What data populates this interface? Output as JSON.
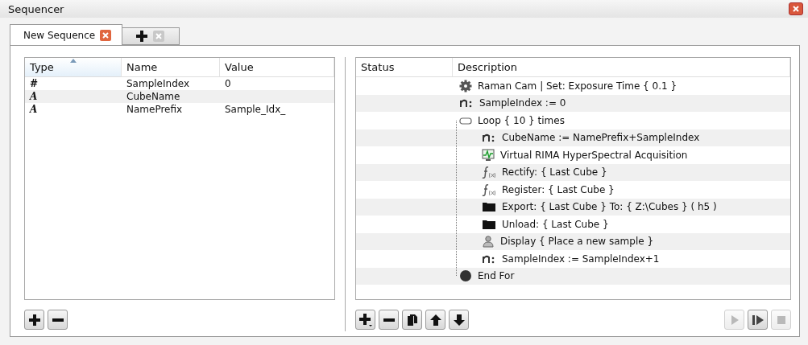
{
  "window": {
    "title": "Sequencer"
  },
  "tabs": [
    {
      "label": "New Sequence",
      "selected": true,
      "kind": "doc"
    },
    {
      "kind": "add",
      "selected": false
    }
  ],
  "variables": {
    "columns": [
      "Type",
      "Name",
      "Value"
    ],
    "rows": [
      {
        "type": "#",
        "name": "SampleIndex",
        "value": "0"
      },
      {
        "type": "A",
        "name": "CubeName",
        "value": ""
      },
      {
        "type": "A",
        "name": "NamePrefix",
        "value": "Sample_Idx_"
      }
    ]
  },
  "steps": {
    "columns": [
      "Status",
      "Description"
    ],
    "rows": [
      {
        "kind": "gear",
        "text": "Raman Cam | Set: Exposure Time { 0.1 }"
      },
      {
        "kind": "var",
        "text": "SampleIndex := 0"
      },
      {
        "kind": "loop",
        "text": "Loop { 10 } times",
        "children": [
          {
            "kind": "var",
            "text": "CubeName := NamePrefix+SampleIndex"
          },
          {
            "kind": "acq",
            "text": "Virtual RIMA HyperSpectral Acquisition"
          },
          {
            "kind": "func",
            "text": "Rectify: { Last Cube }"
          },
          {
            "kind": "func",
            "text": "Register: { Last Cube }"
          },
          {
            "kind": "folder",
            "text": "Export: { Last Cube } To: { Z:\\Cubes } ( h5 )"
          },
          {
            "kind": "folder",
            "text": "Unload: { Last Cube }"
          },
          {
            "kind": "user",
            "text": "Display { Place a new sample }"
          },
          {
            "kind": "var",
            "text": "SampleIndex := SampleIndex+1"
          }
        ]
      },
      {
        "kind": "end",
        "text": "End For"
      }
    ]
  },
  "left_buttons": [
    {
      "kind": "add",
      "disabled": false
    },
    {
      "kind": "remove",
      "disabled": false
    }
  ],
  "step_buttons": [
    {
      "kind": "add-menu",
      "disabled": false
    },
    {
      "kind": "remove",
      "disabled": false
    },
    {
      "kind": "copy",
      "disabled": false
    },
    {
      "kind": "up",
      "disabled": false
    },
    {
      "kind": "down",
      "disabled": false
    }
  ],
  "run_buttons": [
    {
      "kind": "play",
      "disabled": true
    },
    {
      "kind": "step",
      "disabled": false
    },
    {
      "kind": "stop",
      "disabled": true
    }
  ]
}
